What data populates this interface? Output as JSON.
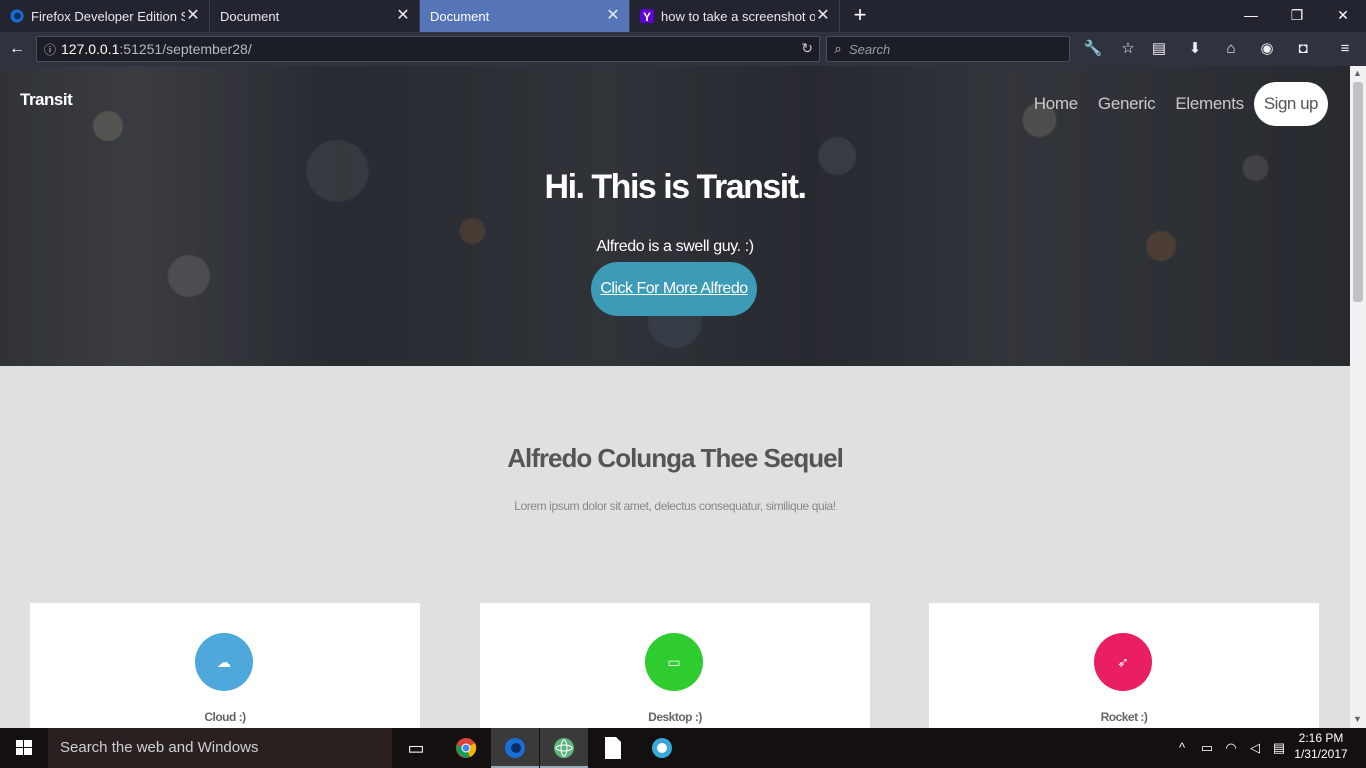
{
  "browser": {
    "tabs": [
      {
        "title": "Firefox Developer Edition Sta",
        "active": false,
        "icon": "firefox-icon"
      },
      {
        "title": "Document",
        "active": false,
        "icon": ""
      },
      {
        "title": "Document",
        "active": true,
        "icon": ""
      },
      {
        "title": "how to take a screenshot on",
        "active": false,
        "icon": "yahoo-icon"
      }
    ],
    "url_host": "127.0.0.1",
    "url_path": ":51251/september28/",
    "search_placeholder": "Search"
  },
  "page": {
    "brand": "Transit",
    "nav": [
      "Home",
      "Generic",
      "Elements"
    ],
    "signup": "Sign up",
    "hero_title": "Hi. This is Transit.",
    "hero_subtitle": "Alfredo is a swell guy. :)",
    "hero_button": "Click For More Alfredo",
    "section_title": "Alfredo Colunga Thee Sequel",
    "section_subtitle": "Lorem ipsum dolor sit amet, delectus consequatur, similique quia!",
    "cards": [
      {
        "label": "Cloud :)",
        "icon": "cloud-icon",
        "color": "#4ea8dc"
      },
      {
        "label": "Desktop :)",
        "icon": "desktop-icon",
        "color": "#2ecc2e"
      },
      {
        "label": "Rocket :)",
        "icon": "rocket-icon",
        "color": "#e91e63"
      }
    ]
  },
  "taskbar": {
    "search_text": "Search the web and Windows",
    "time": "2:16 PM",
    "date": "1/31/2017"
  }
}
